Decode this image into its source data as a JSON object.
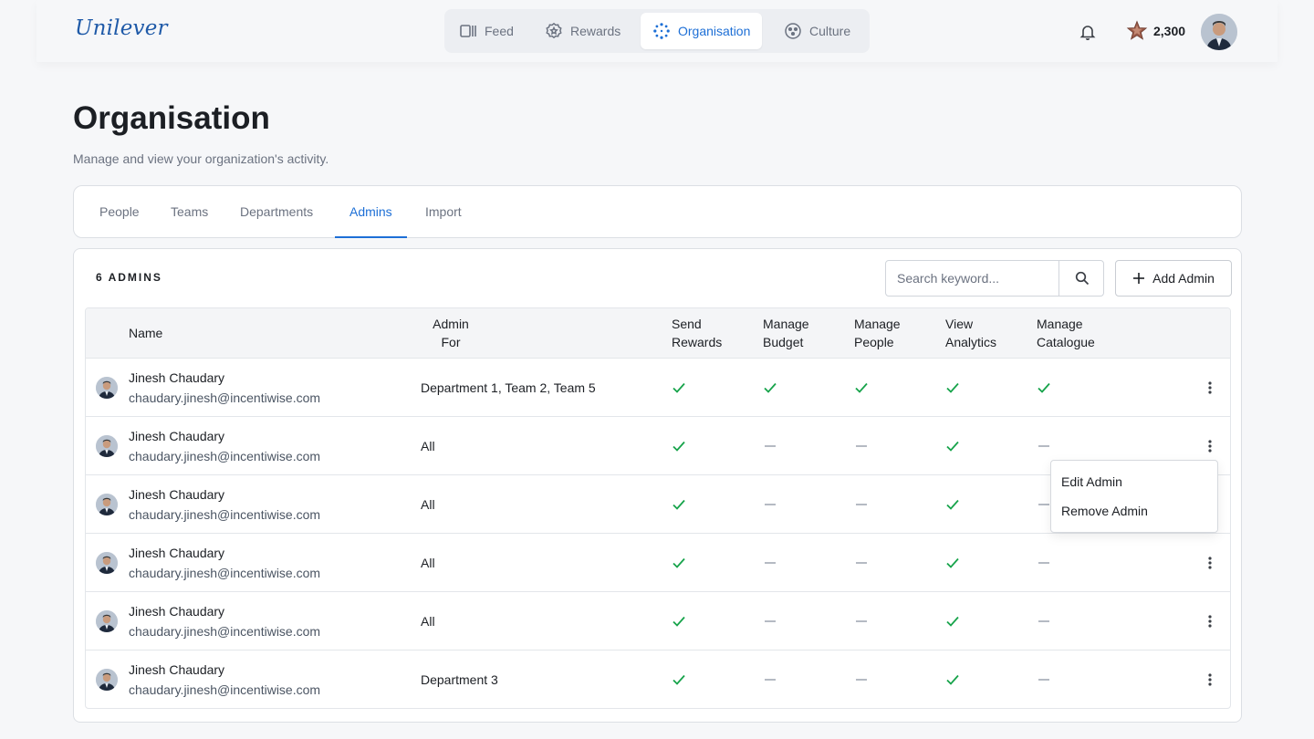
{
  "brand": {
    "logo_text": "Unilever",
    "accent": "#1d6fd6",
    "success": "#16a34a"
  },
  "nav": {
    "items": [
      {
        "label": "Feed",
        "icon": "feed-icon",
        "active": false
      },
      {
        "label": "Rewards",
        "icon": "rewards-icon",
        "active": false
      },
      {
        "label": "Organisation",
        "icon": "organisation-icon",
        "active": true
      },
      {
        "label": "Culture",
        "icon": "culture-icon",
        "active": false
      }
    ]
  },
  "header": {
    "points": "2,300"
  },
  "page": {
    "title": "Organisation",
    "subtitle": "Manage and view your organization's activity."
  },
  "tabs": [
    {
      "label": "People",
      "active": false
    },
    {
      "label": "Teams",
      "active": false
    },
    {
      "label": "Departments",
      "active": false
    },
    {
      "label": "Admins",
      "active": true
    },
    {
      "label": "Import",
      "active": false
    }
  ],
  "admins": {
    "count_label": "6 ADMINS",
    "search_placeholder": "Search keyword...",
    "add_label": "Add Admin",
    "columns": {
      "name": "Name",
      "admin_for_1": "Admin",
      "admin_for_2": "For",
      "send_1": "Send",
      "send_2": "Rewards",
      "budget_1": "Manage",
      "budget_2": "Budget",
      "people_1": "Manage",
      "people_2": "People",
      "analytics_1": "View",
      "analytics_2": "Analytics",
      "catalogue_1": "Manage",
      "catalogue_2": "Catalogue"
    },
    "rows": [
      {
        "name": "Jinesh Chaudary",
        "email": "chaudary.jinesh@incentiwise.com",
        "admin_for": "Department 1, Team 2, Team 5",
        "perms": [
          true,
          true,
          true,
          true,
          true
        ]
      },
      {
        "name": "Jinesh Chaudary",
        "email": "chaudary.jinesh@incentiwise.com",
        "admin_for": "All",
        "perms": [
          true,
          false,
          false,
          true,
          false
        ]
      },
      {
        "name": "Jinesh Chaudary",
        "email": "chaudary.jinesh@incentiwise.com",
        "admin_for": "All",
        "perms": [
          true,
          false,
          false,
          true,
          false
        ]
      },
      {
        "name": "Jinesh Chaudary",
        "email": "chaudary.jinesh@incentiwise.com",
        "admin_for": "All",
        "perms": [
          true,
          false,
          false,
          true,
          false
        ]
      },
      {
        "name": "Jinesh Chaudary",
        "email": "chaudary.jinesh@incentiwise.com",
        "admin_for": "All",
        "perms": [
          true,
          false,
          false,
          true,
          false
        ]
      },
      {
        "name": "Jinesh Chaudary",
        "email": "chaudary.jinesh@incentiwise.com",
        "admin_for": "Department 3",
        "perms": [
          true,
          false,
          false,
          true,
          false
        ]
      }
    ]
  },
  "row_menu": {
    "edit_label": "Edit Admin",
    "remove_label": "Remove Admin"
  }
}
